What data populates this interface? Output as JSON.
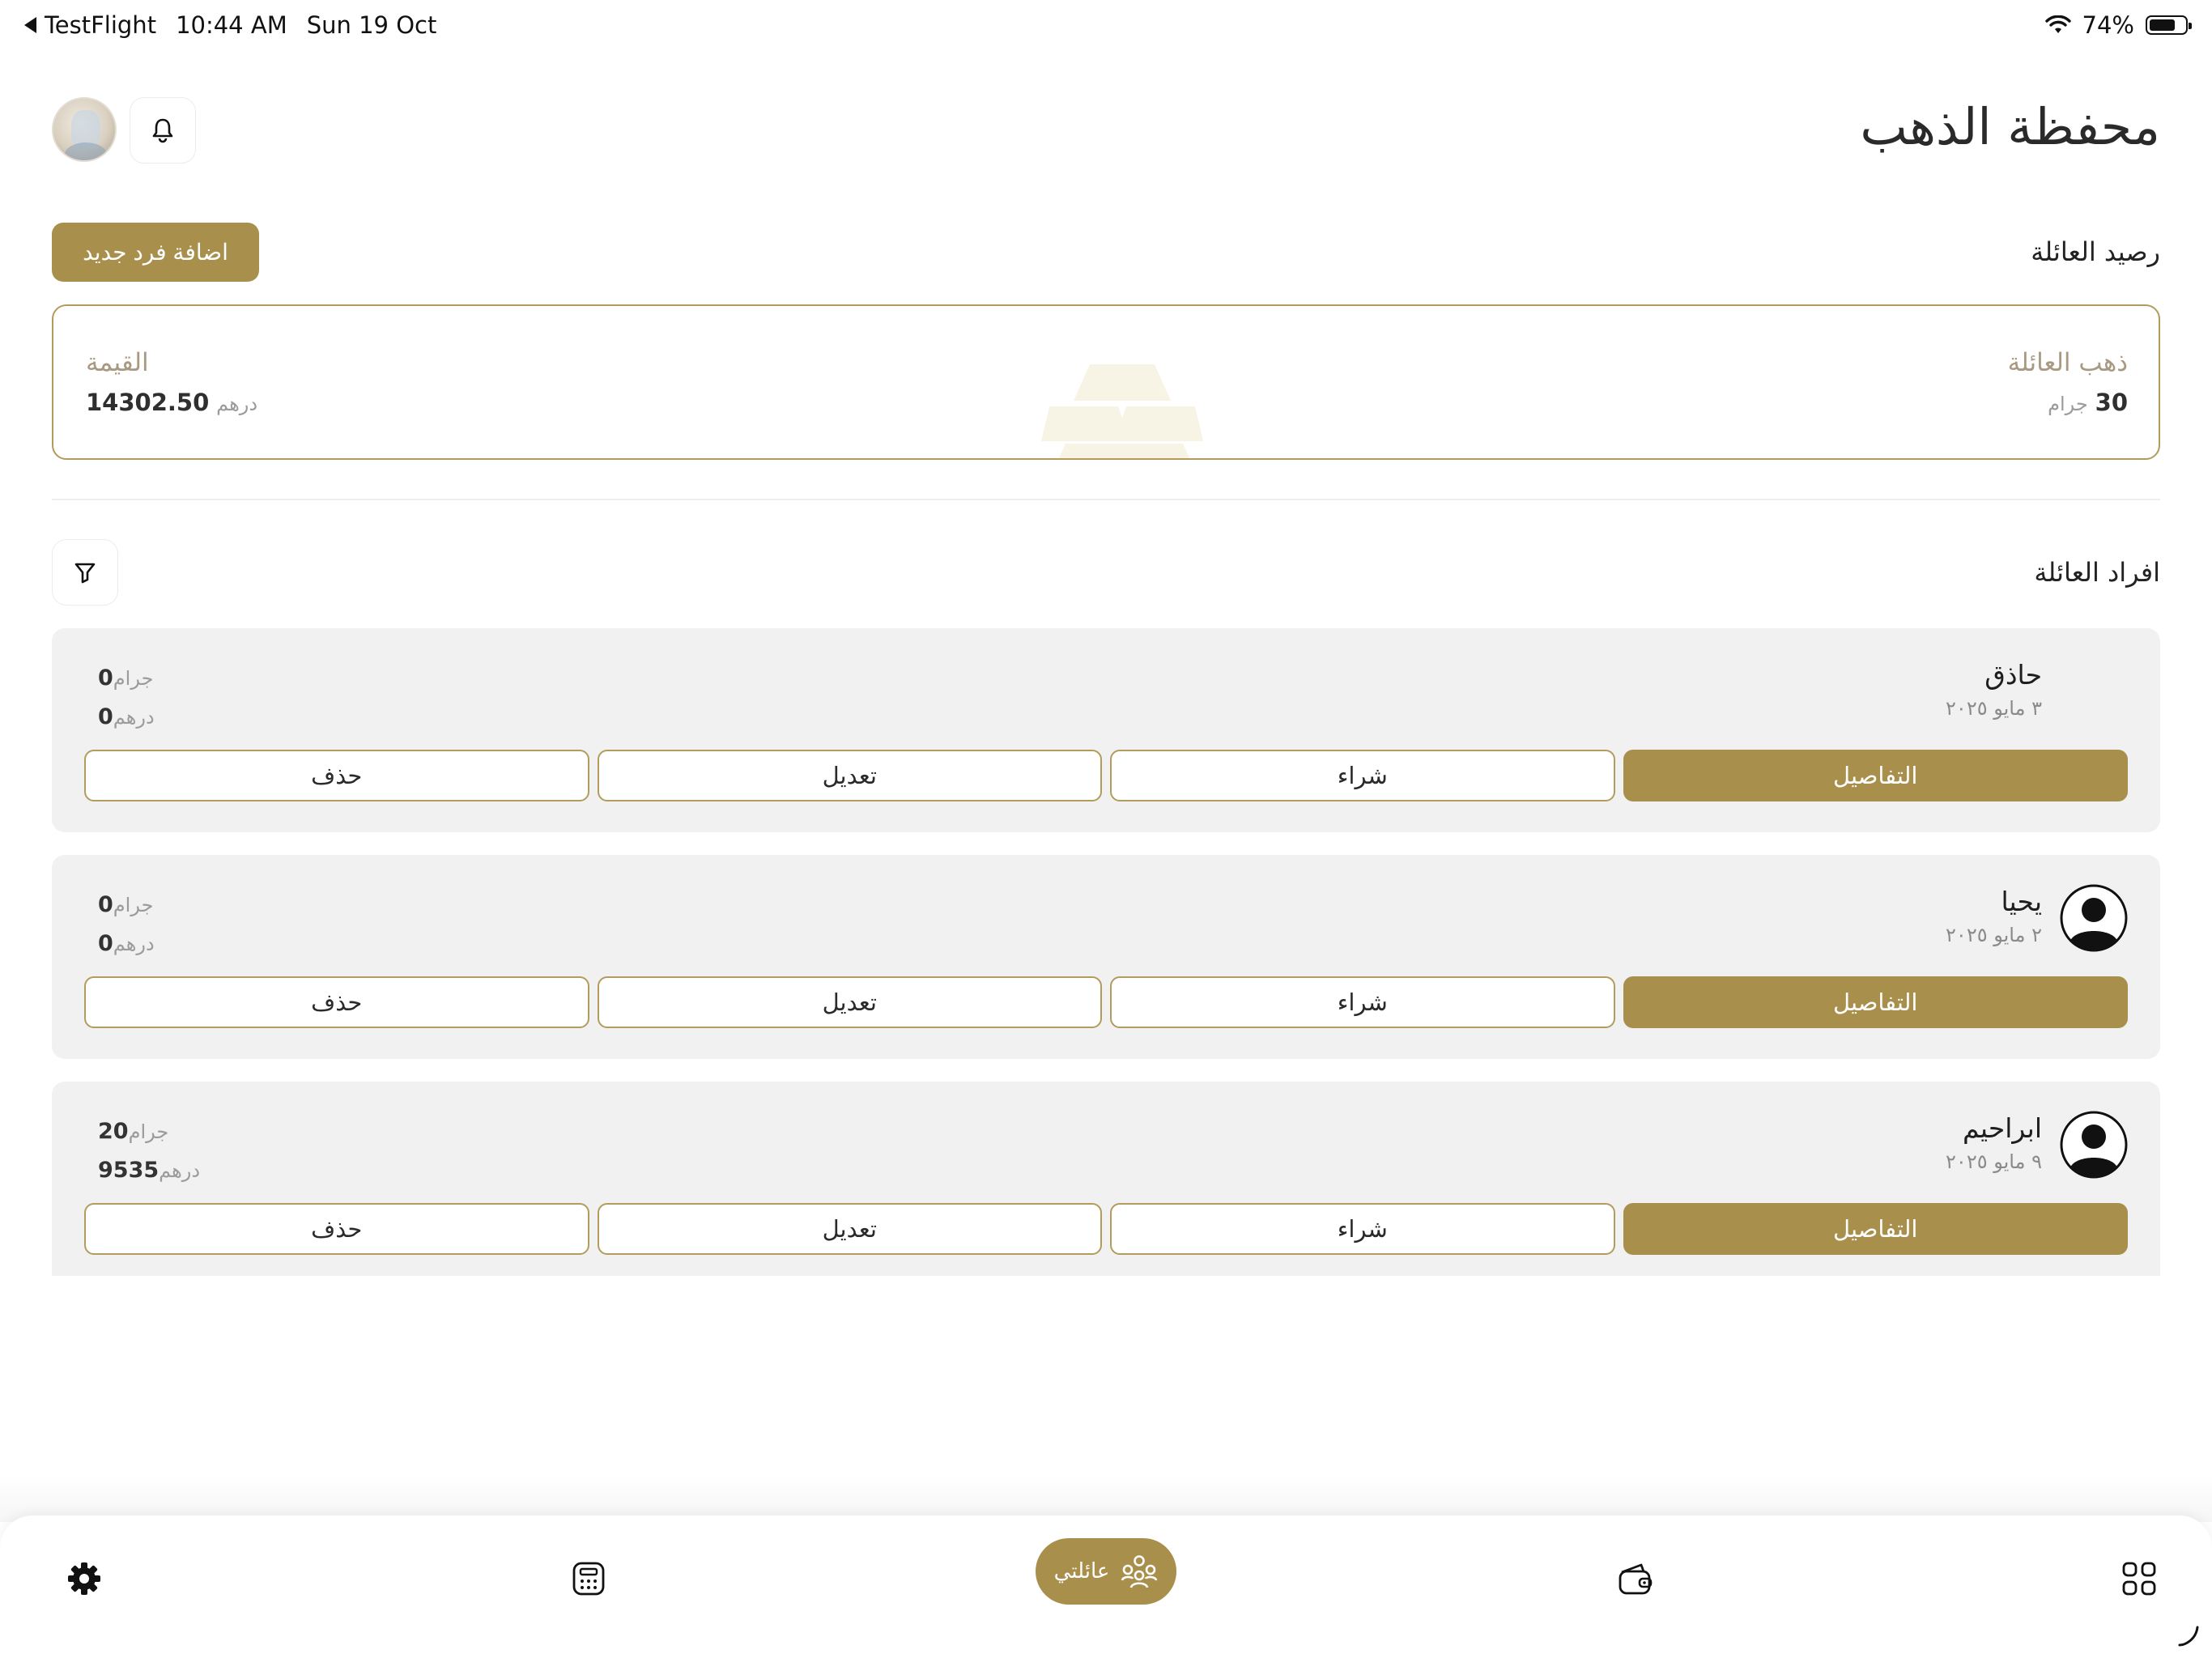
{
  "status_bar": {
    "back_app": "TestFlight",
    "time": "10:44 AM",
    "date": "Sun 19 Oct",
    "battery": "74%",
    "battery_level": 0.74
  },
  "header": {
    "title": "محفظة الذهب",
    "avatar_icon": "user-avatar-illustration",
    "bell_icon": "bell-icon"
  },
  "family_balance": {
    "title": "رصيد العائلة",
    "add_button": "اضافة فرد جديد",
    "gold_label": "ذهب العائلة",
    "gold_value": "30",
    "gold_unit": "جرام",
    "value_label": "القيمة",
    "value_amount": "14302.50",
    "value_unit": "درهم"
  },
  "members_section": {
    "title": "افراد العائلة",
    "filter_icon": "filter-icon"
  },
  "members": [
    {
      "name": "حاذق",
      "date": "٣ مايو ٢٠٢٥",
      "has_avatar": false,
      "grams": "0",
      "grams_unit": "جرام",
      "amount": "0",
      "amount_unit": "درهم",
      "actions": {
        "details": "التفاصيل",
        "buy": "شراء",
        "edit": "تعديل",
        "delete": "حذف"
      }
    },
    {
      "name": "يحيا",
      "date": "٢ مايو ٢٠٢٥",
      "has_avatar": true,
      "grams": "0",
      "grams_unit": "جرام",
      "amount": "0",
      "amount_unit": "درهم",
      "actions": {
        "details": "التفاصيل",
        "buy": "شراء",
        "edit": "تعديل",
        "delete": "حذف"
      }
    },
    {
      "name": "ابراحيم",
      "date": "٩ مايو ٢٠٢٥",
      "has_avatar": true,
      "grams": "20",
      "grams_unit": "جرام",
      "amount": "9535",
      "amount_unit": "درهم",
      "actions": {
        "details": "التفاصيل",
        "buy": "شراء",
        "edit": "تعديل",
        "delete": "حذف"
      }
    }
  ],
  "bottom_nav": {
    "items": [
      {
        "icon": "settings-gear-icon"
      },
      {
        "icon": "calculator-icon"
      },
      {
        "icon": "family-icon",
        "label": "عائلتي",
        "active": true
      },
      {
        "icon": "wallet-icon"
      },
      {
        "icon": "grid-icon"
      }
    ]
  },
  "colors": {
    "accent": "#a98f4c",
    "card_border": "#b39b5c",
    "card_bg": "#f1f1f1"
  }
}
